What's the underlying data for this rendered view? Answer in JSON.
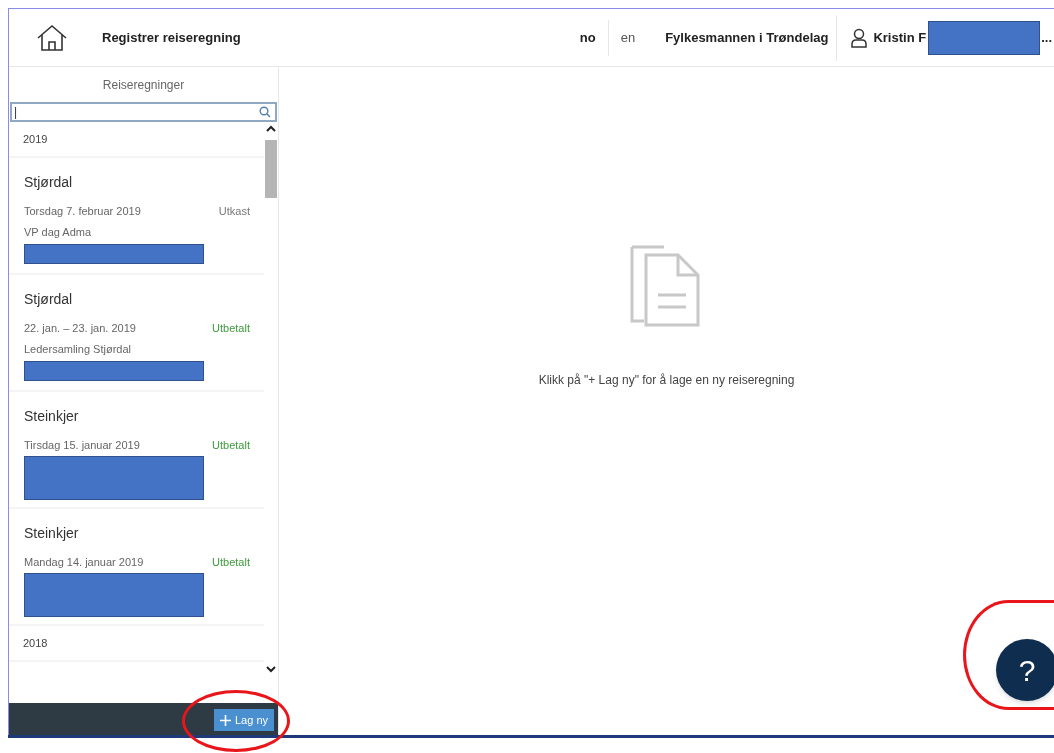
{
  "header": {
    "title": "Registrer reiseregning",
    "languages": [
      {
        "label": "no",
        "selected": true
      },
      {
        "label": "en",
        "selected": false
      }
    ],
    "organization": "Fylkesmannen i Trøndelag",
    "user": {
      "name": "Kristin F",
      "name_redacted": true,
      "suffix": "..."
    }
  },
  "sidebar": {
    "title": "Reiseregninger",
    "search": {
      "value": "|"
    },
    "groups": [
      {
        "year": "2019",
        "items": [
          {
            "place": "Stjørdal",
            "date": "Torsdag 7. februar 2019",
            "status": "Utkast",
            "color": "#777777",
            "description": "VP dag Adma",
            "redacted": true
          },
          {
            "place": "Stjørdal",
            "date": "22. jan. – 23. jan. 2019",
            "status": "Utbetalt",
            "color": "#3c9a3c",
            "description": "Ledersamling Stjørdal",
            "redacted": true
          },
          {
            "place": "Steinkjer",
            "date": "Tirsdag 15. januar 2019",
            "status": "Utbetalt",
            "color": "#3c9a3c",
            "redacted": true
          },
          {
            "place": "Steinkjer",
            "date": "Mandag 14. januar 2019",
            "status": "Utbetalt",
            "color": "#3c9a3c",
            "redacted": true
          }
        ]
      },
      {
        "year": "2018"
      }
    ],
    "new_button": {
      "label": "Lag ny",
      "highlighted": true
    }
  },
  "main": {
    "empty_message": "Klikk på \"+ Lag ny\" for å lage en ny reiseregning"
  },
  "help_button": {
    "label": "?",
    "highlighted": true
  }
}
